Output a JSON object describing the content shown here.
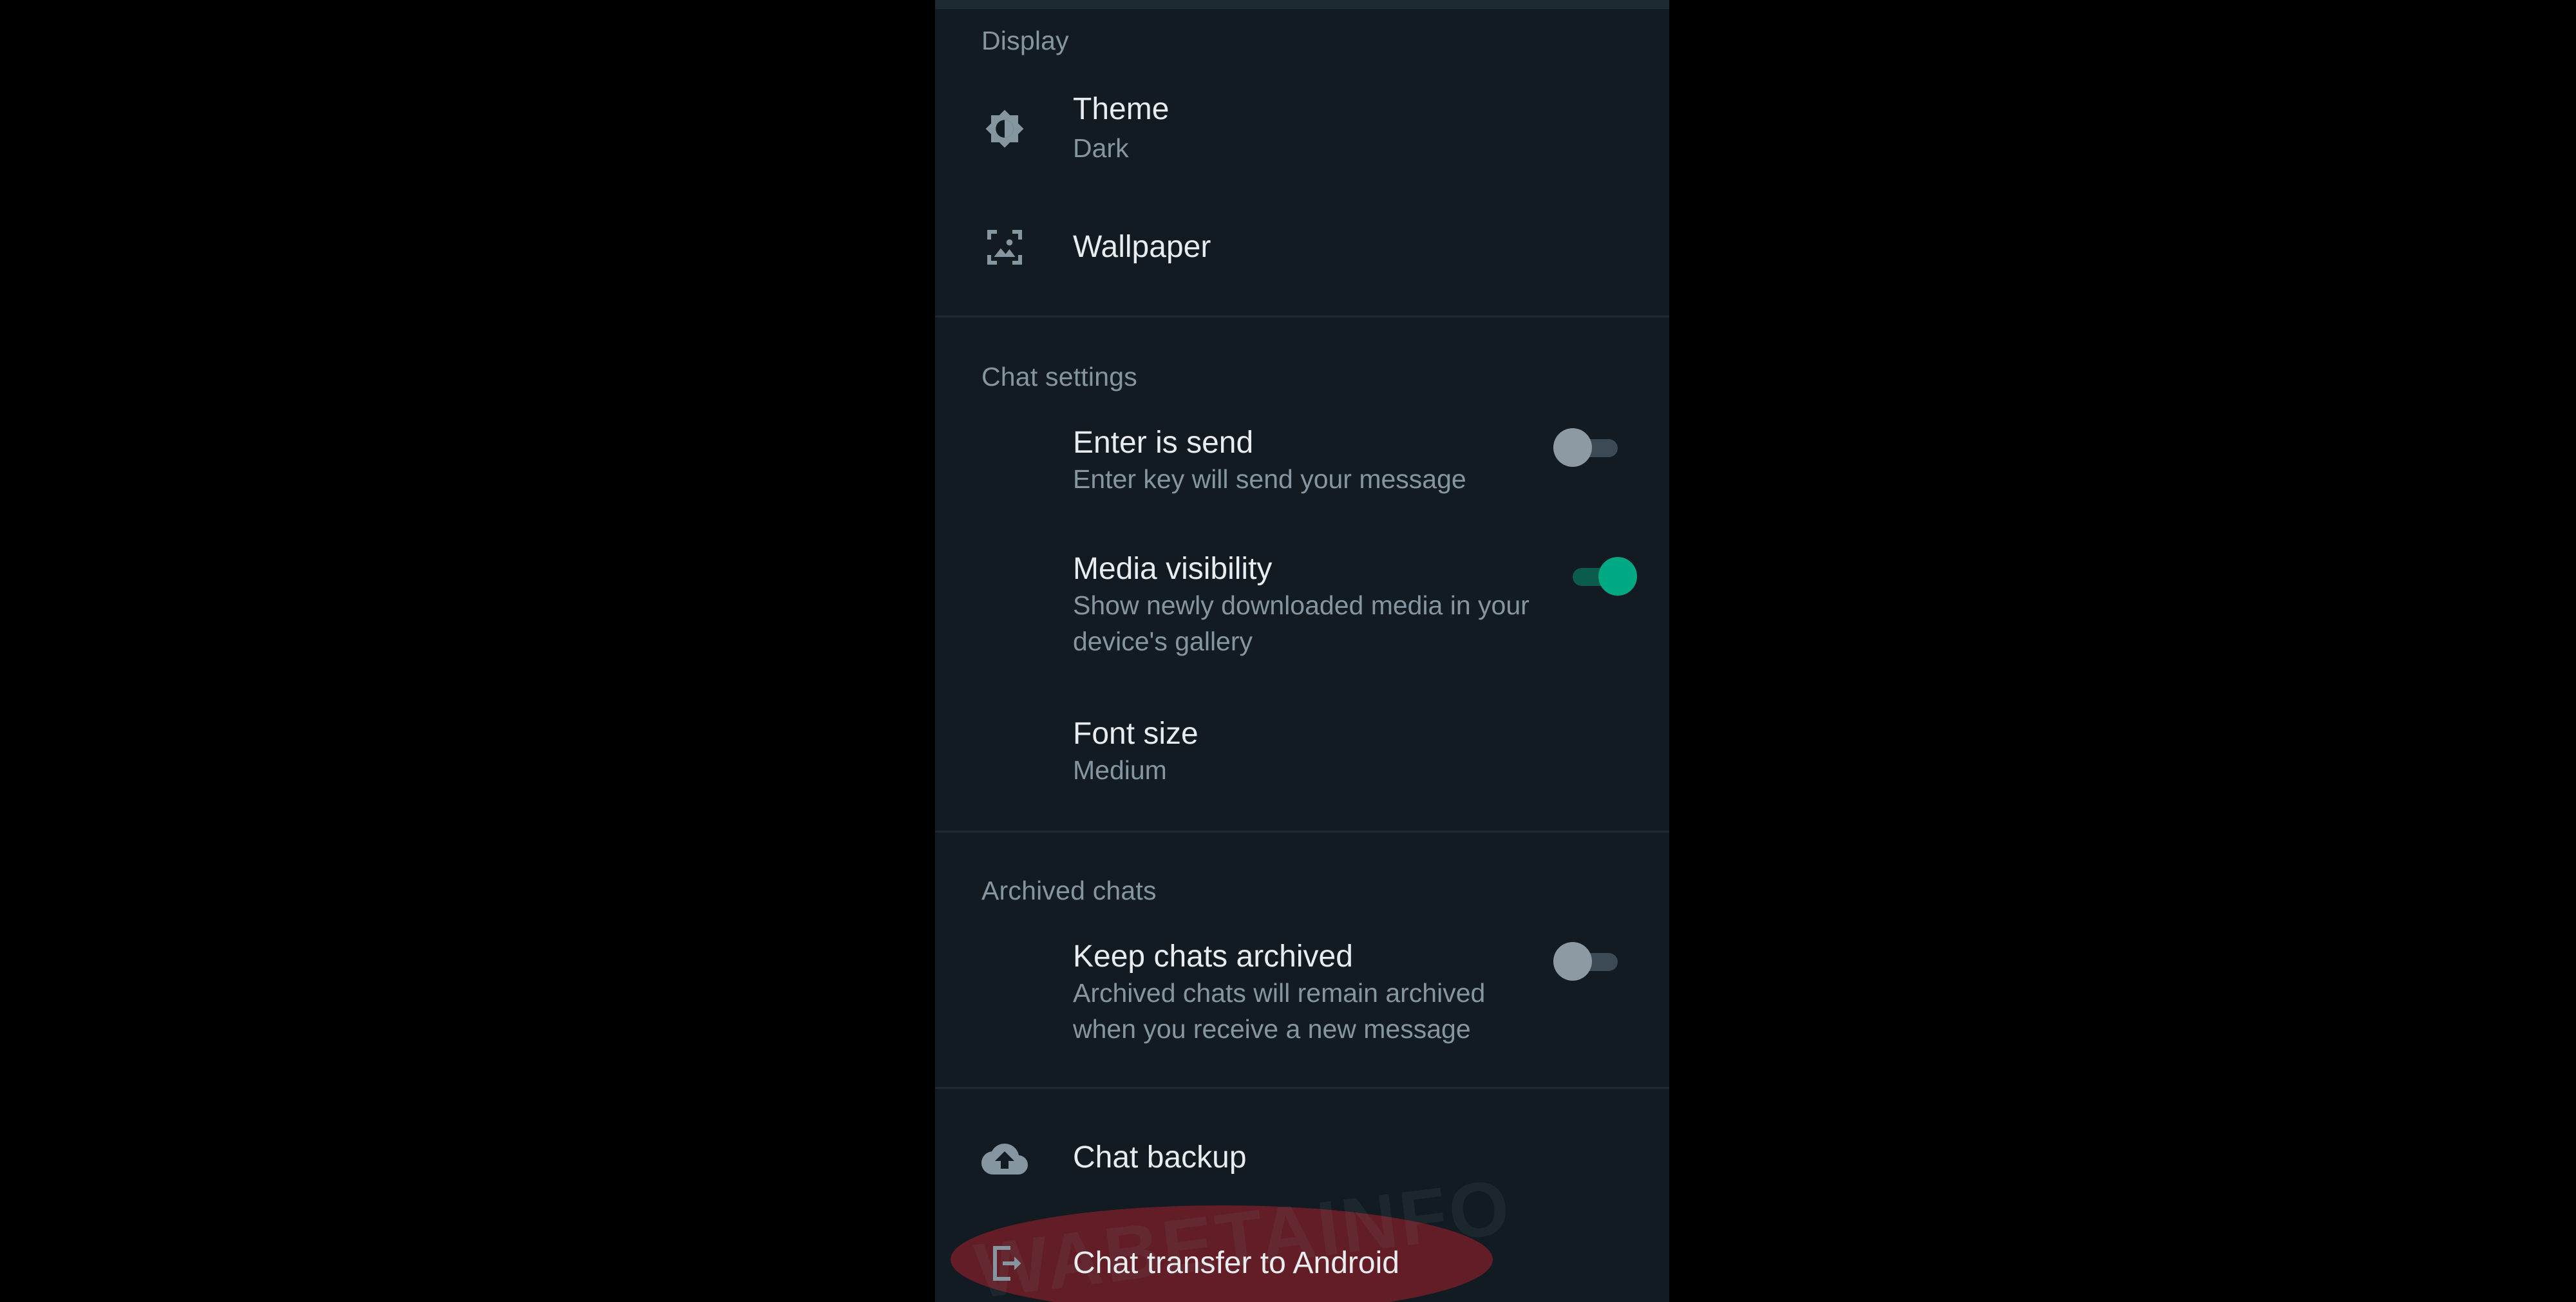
{
  "sections": {
    "display": "Display",
    "chat_settings": "Chat settings",
    "archived_chats": "Archived chats"
  },
  "display": {
    "theme": {
      "title": "Theme",
      "subtitle": "Dark",
      "icon": "brightness-icon"
    },
    "wallpaper": {
      "title": "Wallpaper",
      "icon": "wallpaper-icon"
    }
  },
  "chat_settings": {
    "enter_is_send": {
      "title": "Enter is send",
      "subtitle": "Enter key will send your message",
      "enabled": false
    },
    "media_visibility": {
      "title": "Media visibility",
      "subtitle": "Show newly downloaded media in your device's gallery",
      "enabled": true
    },
    "font_size": {
      "title": "Font size",
      "subtitle": "Medium"
    }
  },
  "archived": {
    "keep_chats_archived": {
      "title": "Keep chats archived",
      "subtitle": "Archived chats will remain archived when you receive a new message",
      "enabled": false
    }
  },
  "backup": {
    "title": "Chat backup",
    "icon": "cloud-upload-icon"
  },
  "transfer": {
    "title": "Chat transfer to Android",
    "icon": "phone-transfer-icon"
  },
  "watermark": "WABETAINFO",
  "colors": {
    "background": "#121b22",
    "title_text": "#e9edef",
    "secondary_text": "#8696a0",
    "accent": "#00a884",
    "highlight": "#961e28"
  }
}
